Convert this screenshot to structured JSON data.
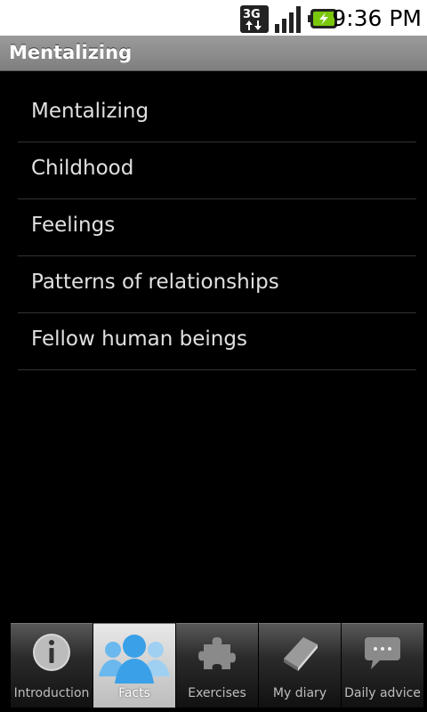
{
  "status_bar": {
    "network": "3G",
    "time": "9:36 PM",
    "icons": [
      "3g-icon",
      "signal-icon",
      "battery-charging-icon"
    ]
  },
  "title_bar": {
    "title": "Mentalizing"
  },
  "list": {
    "items": [
      "Mentalizing",
      "Childhood",
      "Feelings",
      "Patterns of relationships",
      "Fellow human beings"
    ]
  },
  "tabs": [
    {
      "label": "Introduction",
      "icon": "info-icon",
      "active": false
    },
    {
      "label": "Facts",
      "icon": "people-icon",
      "active": true
    },
    {
      "label": "Exercises",
      "icon": "puzzle-icon",
      "active": false
    },
    {
      "label": "My diary",
      "icon": "book-icon",
      "active": false
    },
    {
      "label": "Daily advice",
      "icon": "speech-bubble-icon",
      "active": false
    }
  ],
  "colors": {
    "accent": "#3aa0e8",
    "battery": "#7ac70c"
  }
}
